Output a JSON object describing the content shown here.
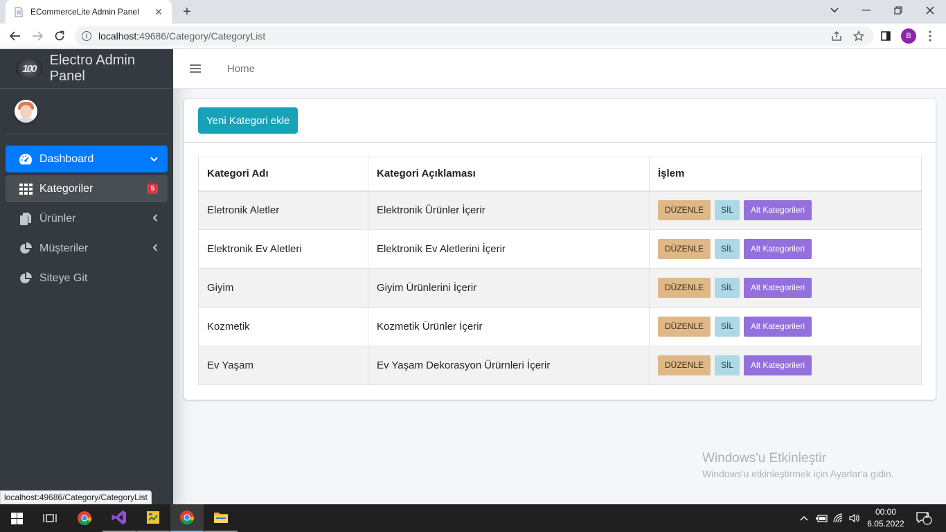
{
  "browser": {
    "tab_title": "ECommerceLite Admin Panel",
    "url_host": "localhost:",
    "url_path": "49686/Category/CategoryList",
    "profile_initial": "B",
    "status_url": "localhost:49686/Category/CategoryList"
  },
  "sidebar": {
    "brand_logo_text": "100",
    "brand": "Electro Admin Panel",
    "items": [
      {
        "label": "Dashboard",
        "icon": "dashboard-gauge-icon",
        "state": "active"
      },
      {
        "label": "Kategoriler",
        "icon": "grid-icon",
        "badge": "5",
        "state": "highlighted"
      },
      {
        "label": "Ürünler",
        "icon": "copy-icon"
      },
      {
        "label": "Müşteriler",
        "icon": "pie-chart-icon"
      },
      {
        "label": "Siteye Git",
        "icon": "pie-chart-icon"
      }
    ]
  },
  "topnav": {
    "home": "Home"
  },
  "main": {
    "add_button": "Yeni Kategori ekle",
    "table": {
      "headers": [
        "Kategori Adı",
        "Kategori Açıklaması",
        "İşlem"
      ],
      "rows": [
        {
          "name": "Eletronik Aletler",
          "desc": "Elektronik Ürünler İçerir"
        },
        {
          "name": "Elektronik Ev Aletleri",
          "desc": "Elektronik Ev Aletlerini İçerir"
        },
        {
          "name": "Giyim",
          "desc": "Giyim Ürünlerini İçerir"
        },
        {
          "name": "Kozmetik",
          "desc": "Kozmetik Ürünler İçerir"
        },
        {
          "name": "Ev Yaşam",
          "desc": "Ev Yaşam Dekorasyon Ürürnleri İçerir"
        }
      ],
      "actions": {
        "edit": "DÜZENLE",
        "delete": "SİL",
        "sub": "Alt Kategorileri"
      }
    }
  },
  "watermark": {
    "line1": "Windows'u Etkinleştir",
    "line2": "Windows'u etkinleştirmek için Ayarlar'a gidin."
  },
  "taskbar": {
    "time": "00:00",
    "date": "6.05.2022",
    "notifications": "2"
  },
  "colors": {
    "sidebar_bg": "#343a40",
    "active_nav": "#007bff",
    "add_button": "#17a2b8",
    "edit_button": "#deb887",
    "delete_button": "#add8e6",
    "sub_button": "#9370db",
    "badge": "#dc3545"
  }
}
